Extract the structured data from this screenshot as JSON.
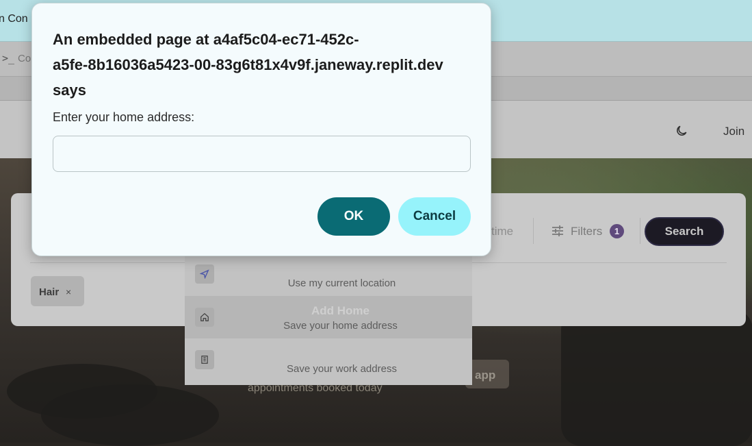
{
  "browser": {
    "top_text": "n Con",
    "toolbar_prompt": ">_",
    "toolbar_text": "Co"
  },
  "header": {
    "theme_icon": "moon-icon",
    "join_label": "Join"
  },
  "search_card": {
    "time_placeholder": "time",
    "filters_label": "Filters",
    "filters_count": "1",
    "search_label": "Search",
    "chips": [
      {
        "label": "Hair",
        "remove": "×"
      }
    ]
  },
  "location_dropdown": {
    "items": [
      {
        "icon": "navigation-arrow-icon",
        "title": "",
        "subtitle": "Use my current location"
      },
      {
        "icon": "home-icon",
        "title": "Add Home",
        "subtitle": "Save your home address"
      },
      {
        "icon": "building-icon",
        "title": "",
        "subtitle": "Save your work address"
      }
    ]
  },
  "hero": {
    "tagline": "appointments booked today",
    "app_label": "app"
  },
  "dialog": {
    "title": "An embedded page at a4af5c04-ec71-452c-\na5fe-8b16036a5423-00-83g6t81x4v9f.janeway.replit.dev\n says",
    "message": "Enter your home address:",
    "input_value": "",
    "ok_label": "OK",
    "cancel_label": "Cancel"
  }
}
